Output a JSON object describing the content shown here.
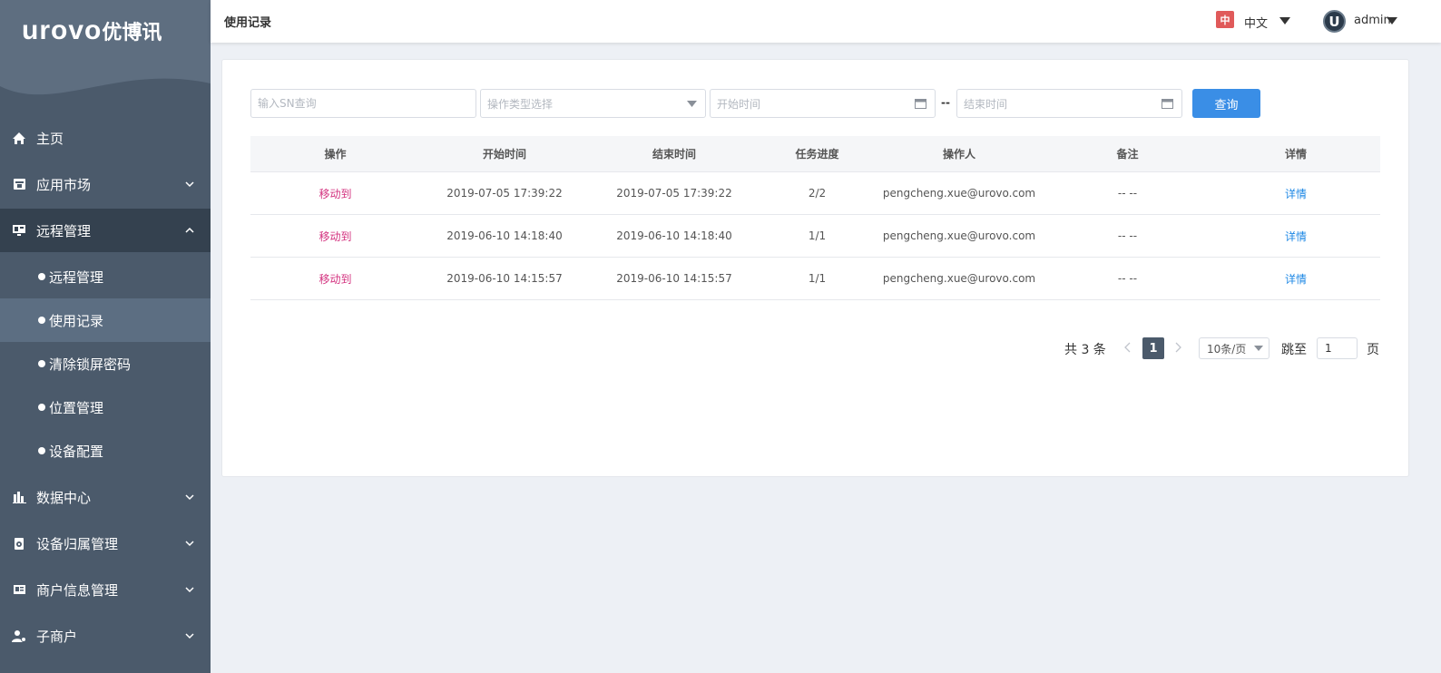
{
  "brand": {
    "logo_latin": "urovo",
    "logo_cn": "优博讯"
  },
  "sidebar": {
    "items": [
      {
        "label": "主页",
        "icon": "home-icon"
      },
      {
        "label": "应用市场",
        "icon": "app-market-icon"
      },
      {
        "label": "远程管理",
        "icon": "monitor-icon"
      },
      {
        "label": "数据中心",
        "icon": "bar-chart-icon"
      },
      {
        "label": "设备归属管理",
        "icon": "device-icon"
      },
      {
        "label": "商户信息管理",
        "icon": "id-card-icon"
      },
      {
        "label": "子商户",
        "icon": "user-settings-icon"
      }
    ],
    "sub_items": [
      "远程管理",
      "使用记录",
      "清除锁屏密码",
      "位置管理",
      "设备配置"
    ]
  },
  "header": {
    "title": "使用记录",
    "lang_flag": "中",
    "lang_label": "中文",
    "avatar_letter": "U",
    "user": "admin"
  },
  "filters": {
    "sn_placeholder": "输入SN查询",
    "type_placeholder": "操作类型选择",
    "start_placeholder": "开始时间",
    "range_sep": "--",
    "end_placeholder": "结束时间",
    "query_label": "查询"
  },
  "table": {
    "columns": [
      "操作",
      "开始时间",
      "结束时间",
      "任务进度",
      "操作人",
      "备注",
      "详情"
    ],
    "rows": [
      [
        "移动到",
        "2019-07-05 17:39:22",
        "2019-07-05 17:39:22",
        "2/2",
        "pengcheng.xue@urovo.com",
        "-- --",
        "详情"
      ],
      [
        "移动到",
        "2019-06-10 14:18:40",
        "2019-06-10 14:18:40",
        "1/1",
        "pengcheng.xue@urovo.com",
        "-- --",
        "详情"
      ],
      [
        "移动到",
        "2019-06-10 14:15:57",
        "2019-06-10 14:15:57",
        "1/1",
        "pengcheng.xue@urovo.com",
        "-- --",
        "详情"
      ]
    ]
  },
  "pagination": {
    "total": "共 3 条",
    "current_page": "1",
    "page_size": "10条/页",
    "jump_label": "跳至",
    "jump_value": "1",
    "page_suffix": "页"
  },
  "colors": {
    "sidebar_bg": "#4b5a6b",
    "sidebar_active": "#34414f",
    "accent": "#3a8ee6",
    "op_link": "#d3327f",
    "detail_link": "#1e88e5"
  }
}
